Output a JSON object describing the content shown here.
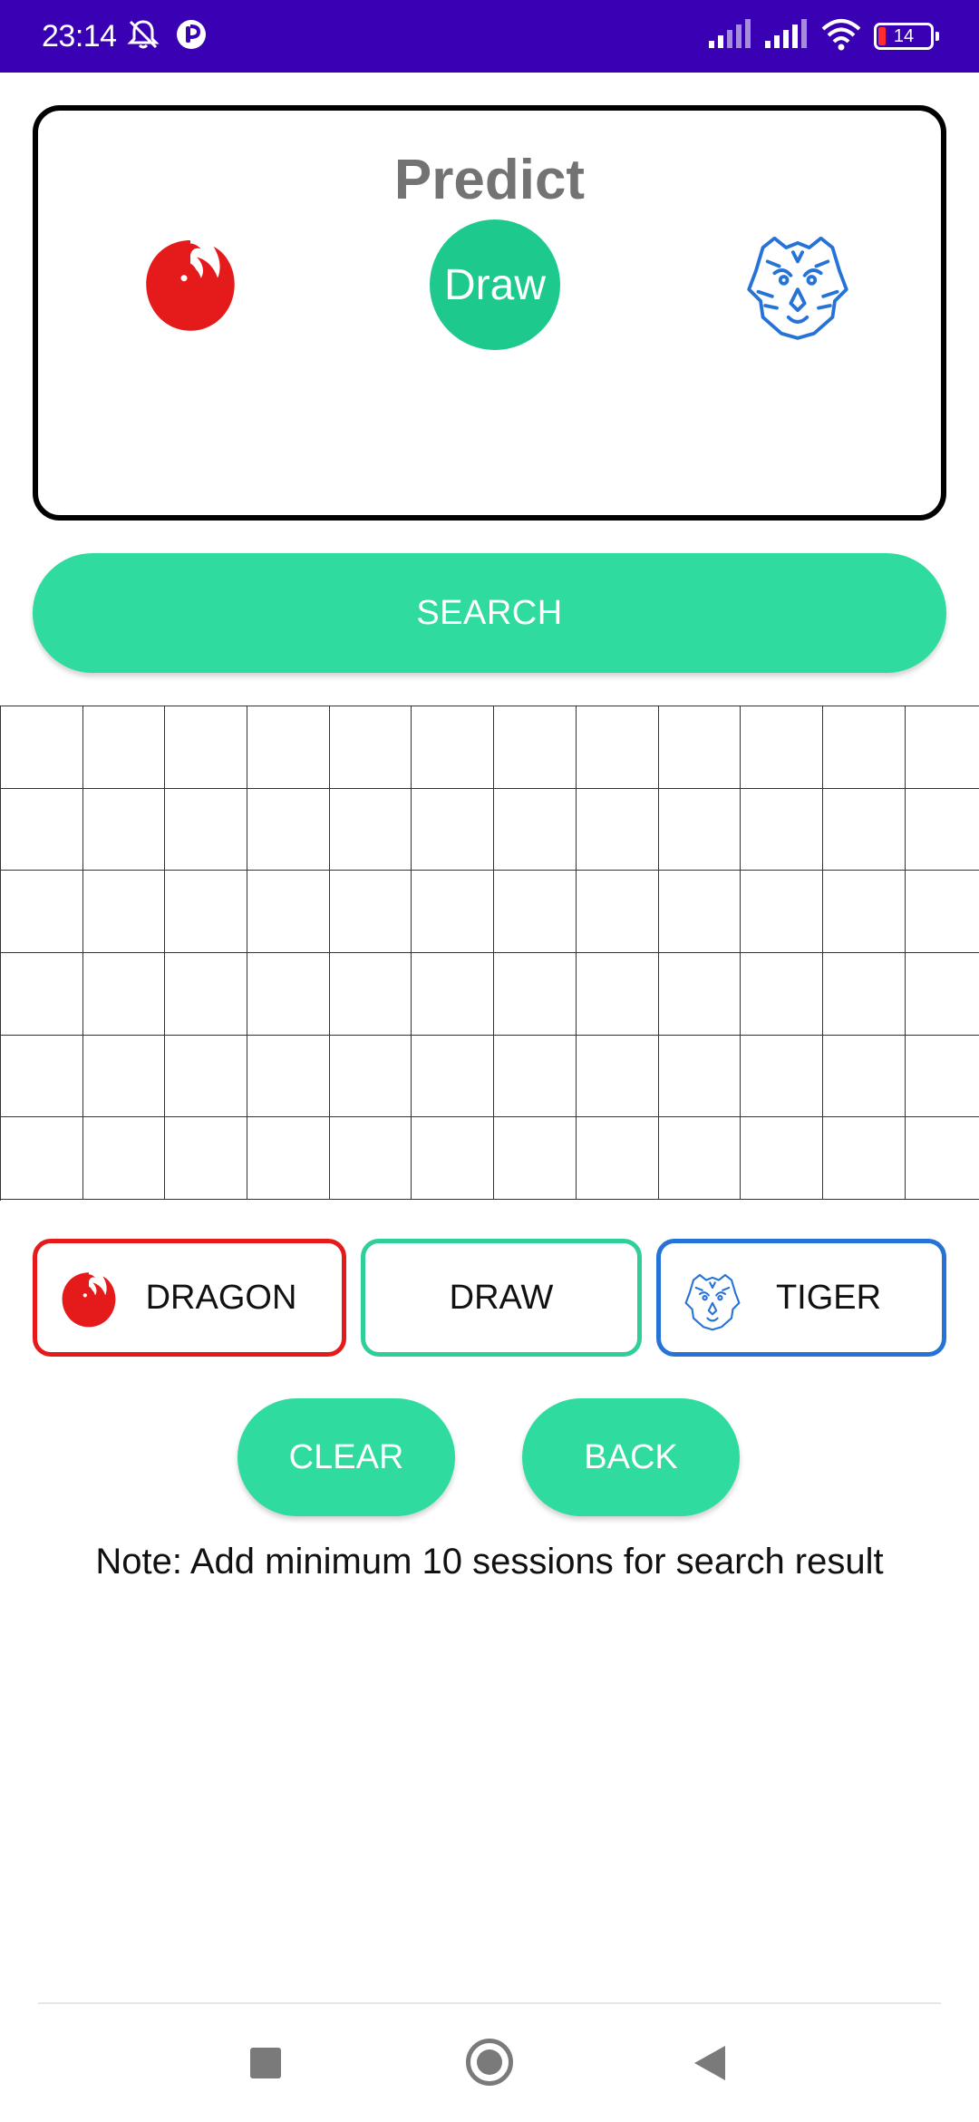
{
  "status_bar": {
    "time": "23:14",
    "battery": "14",
    "background": "#3a00b3"
  },
  "predict": {
    "title": "Predict",
    "prediction": "Draw",
    "left_icon": "dragon-icon",
    "right_icon": "tiger-icon"
  },
  "search": {
    "label": "SEARCH"
  },
  "grid": {
    "columns": 12,
    "rows": 6
  },
  "choices": {
    "dragon": {
      "label": "DRAGON",
      "color": "#e51b1b",
      "icon": "dragon-icon"
    },
    "draw": {
      "label": "DRAW",
      "color": "#2fcf97"
    },
    "tiger": {
      "label": "TIGER",
      "color": "#2673d8",
      "icon": "tiger-icon"
    }
  },
  "actions": {
    "clear_label": "CLEAR",
    "back_label": "BACK"
  },
  "note": "Note: Add minimum 10 sessions for search result",
  "colors": {
    "accent": "#2fdb9e",
    "draw_circle": "#1ec98e",
    "dragon_red": "#e51b1b",
    "tiger_blue": "#2673d8"
  },
  "nav": {
    "recent_icon": "recent-apps-icon",
    "home_icon": "home-icon",
    "back_icon": "back-triangle-icon"
  }
}
